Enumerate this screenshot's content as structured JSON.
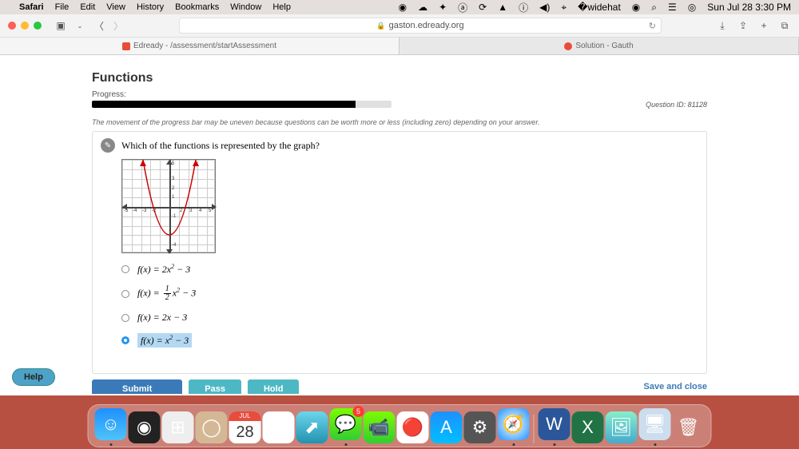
{
  "menubar": {
    "apple": "",
    "appname": "Safari",
    "items": [
      "File",
      "Edit",
      "View",
      "History",
      "Bookmarks",
      "Window",
      "Help"
    ],
    "clock": "Sun Jul 28  3:30 PM"
  },
  "browser": {
    "url": "gaston.edready.org",
    "tab1": "Edready - /assessment/startAssessment",
    "tab2": "Solution - Gauth"
  },
  "page": {
    "title": "Functions",
    "progress_label": "Progress:",
    "question_id": "Question ID: 81128",
    "progress_note": "The movement of the progress bar may be uneven because questions can be worth more or less (including zero) depending on your answer.",
    "question": "Which of the functions is represented by the graph?",
    "options": {
      "a": "f(x) = 2x² − 3",
      "c": "f(x) = 2x − 3",
      "d": "f(x) = x² − 3"
    },
    "selected": 3
  },
  "buttons": {
    "help": "Help",
    "submit": "Submit",
    "pass": "Pass",
    "hold": "Hold",
    "save_close": "Save and close"
  },
  "dock": {
    "cal_month": "JUL",
    "cal_day": "28",
    "badge": "5"
  },
  "chart_data": {
    "type": "line",
    "title": "",
    "xlabel": "",
    "ylabel": "",
    "xlim": [
      -5,
      5
    ],
    "ylim": [
      -5,
      5
    ],
    "function": "y = x^2 - 3",
    "x": [
      -3,
      -2,
      -1,
      0,
      1,
      2,
      3
    ],
    "y": [
      6,
      1,
      -2,
      -3,
      -2,
      1,
      6
    ],
    "vertex": [
      0,
      -3
    ]
  }
}
